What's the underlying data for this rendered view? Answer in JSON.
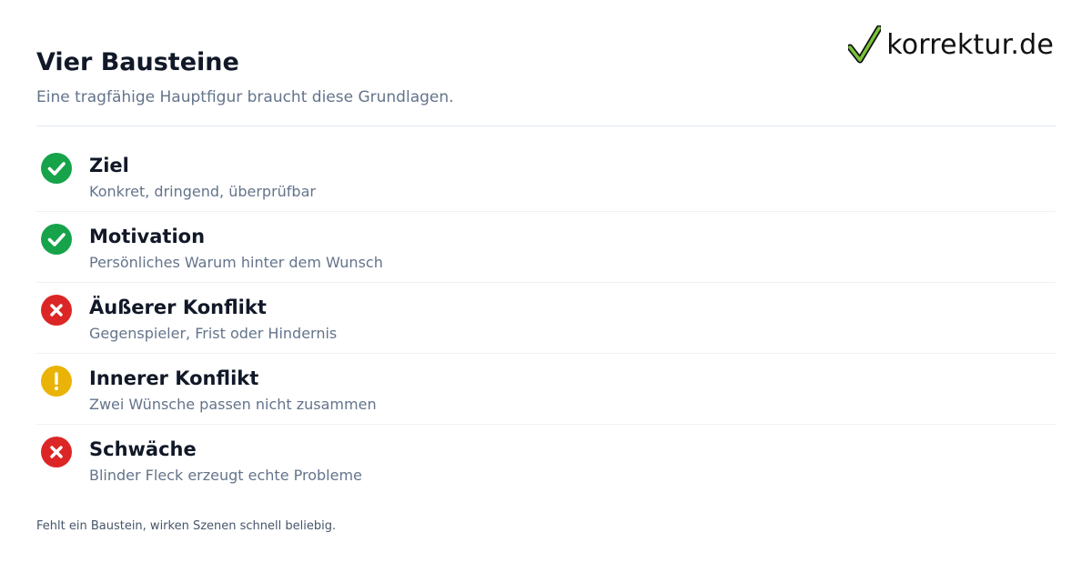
{
  "logo": {
    "text": "korrektur.de",
    "icon": "checkmark-icon",
    "check_color": "#79c33a"
  },
  "header": {
    "title": "Vier Bausteine",
    "subtitle": "Eine tragfähige Hauptfigur braucht diese Grundlagen."
  },
  "items": [
    {
      "title": "Ziel",
      "description": "Konkret, dringend, überprüfbar",
      "status": "ok",
      "icon": "check-circle-icon"
    },
    {
      "title": "Motivation",
      "description": "Persönliches Warum hinter dem Wunsch",
      "status": "ok",
      "icon": "check-circle-icon"
    },
    {
      "title": "Äußerer Konflikt",
      "description": "Gegenspieler, Frist oder Hindernis",
      "status": "error",
      "icon": "x-circle-icon"
    },
    {
      "title": "Innerer Konflikt",
      "description": "Zwei Wünsche passen nicht zusammen",
      "status": "warning",
      "icon": "exclamation-circle-icon"
    },
    {
      "title": "Schwäche",
      "description": "Blinder Fleck erzeugt echte Probleme",
      "status": "error",
      "icon": "x-circle-icon"
    }
  ],
  "status_colors": {
    "ok": "#16a34a",
    "error": "#dc2626",
    "warning": "#eab308"
  },
  "footer": {
    "text": "Fehlt ein Baustein, wirken Szenen schnell beliebig."
  }
}
